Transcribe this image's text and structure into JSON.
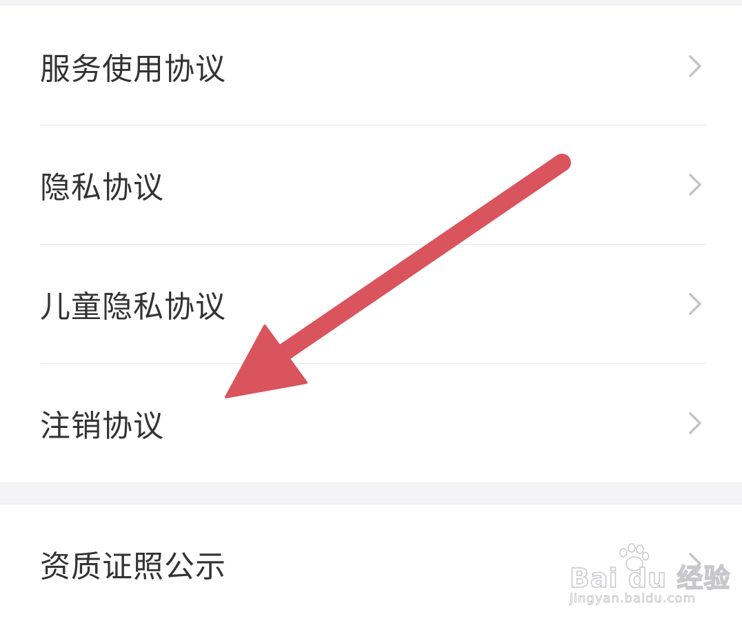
{
  "settings_list": {
    "group1": [
      {
        "label": "服务使用协议",
        "icon": "chevron-right-icon"
      },
      {
        "label": "隐私协议",
        "icon": "chevron-right-icon"
      },
      {
        "label": "儿童隐私协议",
        "icon": "chevron-right-icon"
      },
      {
        "label": "注销协议",
        "icon": "chevron-right-icon"
      }
    ],
    "group2": [
      {
        "label": "资质证照公示",
        "icon": "chevron-right-icon"
      }
    ]
  },
  "annotation": {
    "type": "pointer-arrow",
    "color": "#d9545d",
    "points_to": "注销协议"
  },
  "watermark": {
    "logo": "Bai du 经验",
    "url": "jingyan.baidu.com"
  },
  "colors": {
    "text": "#333333",
    "chevron": "#c4c4c8",
    "divider": "#e6e6e8",
    "group_gap": "#f4f4f6",
    "arrow": "#d9545d"
  }
}
